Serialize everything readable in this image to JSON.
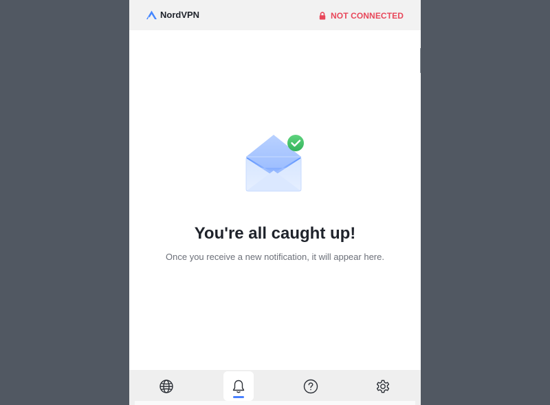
{
  "app": {
    "brand_name": "NordVPN",
    "logo_icon": "nordvpn-mountain-icon",
    "brand_color": "#4687ff"
  },
  "header": {
    "status_text": "NOT CONNECTED",
    "status_icon": "lock-icon",
    "status_color": "#e8475a"
  },
  "empty_state": {
    "illustration": "envelope-check-icon",
    "title": "You're all caught up!",
    "message": "Once you receive a new notification, it will appear here."
  },
  "bottom_nav": {
    "items": [
      {
        "id": "countries",
        "icon": "globe-icon",
        "active": false
      },
      {
        "id": "notifications",
        "icon": "bell-icon",
        "active": true
      },
      {
        "id": "help",
        "icon": "help-circle-icon",
        "active": false
      },
      {
        "id": "settings",
        "icon": "gear-icon",
        "active": false
      }
    ],
    "accent_color": "#4880ff"
  }
}
